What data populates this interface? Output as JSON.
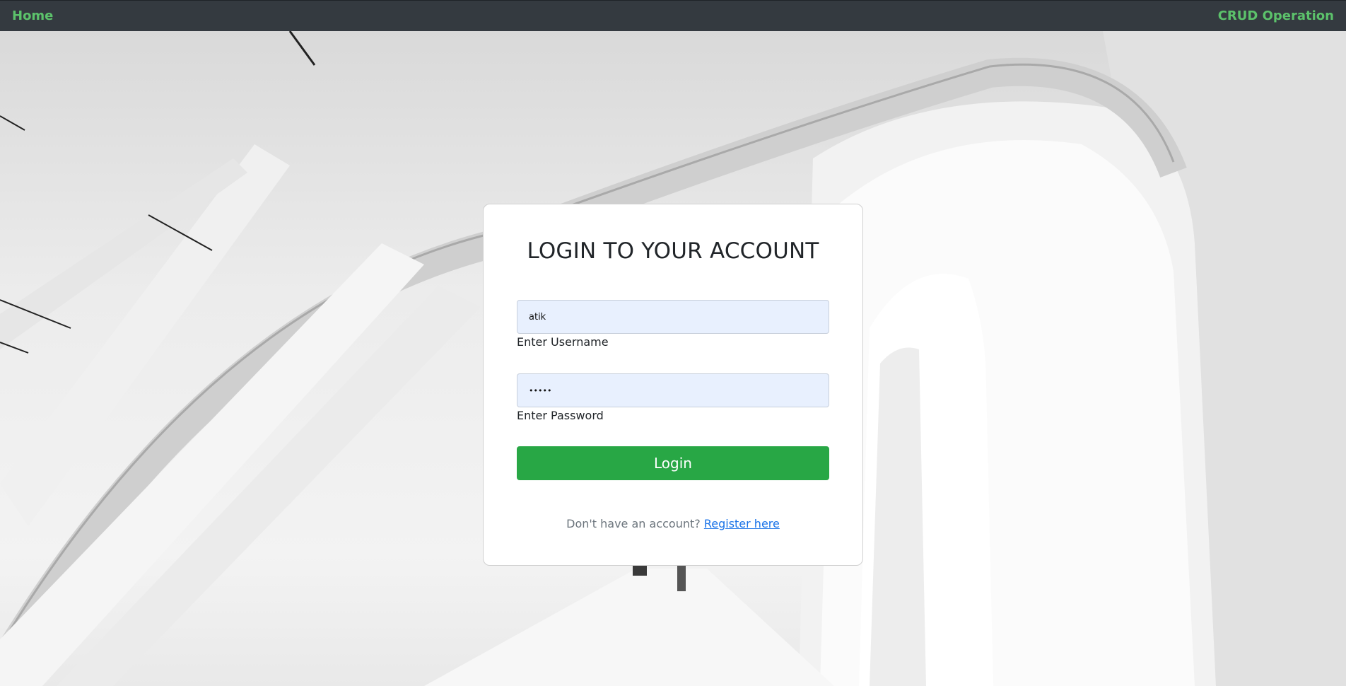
{
  "nav": {
    "home": "Home",
    "brand": "CRUD Operation"
  },
  "login": {
    "title": "LOGIN TO YOUR ACCOUNT",
    "username_value": "atik",
    "username_label": "Enter Username",
    "password_value": "•••••",
    "password_label": "Enter Password",
    "button": "Login",
    "register_prompt": "Don't have an account?",
    "register_link": "Register here"
  },
  "colors": {
    "navbar": "#343a40",
    "nav_text": "#5cc26b",
    "button": "#28a745",
    "link": "#1a73e8"
  }
}
